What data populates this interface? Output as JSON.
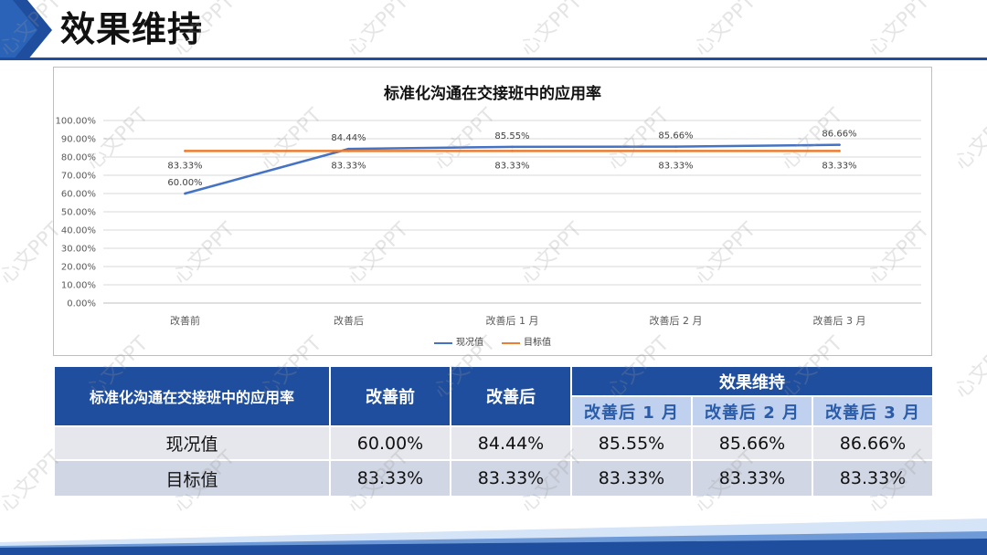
{
  "slide": {
    "title": "效果维持",
    "watermark": "心文PPT",
    "colors": {
      "primary": "#1f4e9e",
      "subheader_bg": "#bfd1ee",
      "subheader_text": "#2a5caa",
      "row_1_bg": "#e6e7ec",
      "row_2_bg": "#d0d6e3"
    }
  },
  "chart_data": {
    "type": "line",
    "title": "标准化沟通在交接班中的应用率",
    "categories": [
      "改善前",
      "改善后",
      "改善后 1 月",
      "改善后 2 月",
      "改善后 3 月"
    ],
    "ylim": [
      0,
      100
    ],
    "yticks": [
      0,
      10,
      20,
      30,
      40,
      50,
      60,
      70,
      80,
      90,
      100
    ],
    "ytick_labels": [
      "0.00%",
      "10.00%",
      "20.00%",
      "30.00%",
      "40.00%",
      "50.00%",
      "60.00%",
      "70.00%",
      "80.00%",
      "90.00%",
      "100.00%"
    ],
    "grid": true,
    "legend": "bottom",
    "series": [
      {
        "name": "现况值",
        "color": "#4472c4",
        "values": [
          60.0,
          84.44,
          85.55,
          85.66,
          86.66
        ],
        "labels": [
          "60.00%",
          "84.44%",
          "85.55%",
          "85.66%",
          "86.66%"
        ],
        "label_position": "above"
      },
      {
        "name": "目标值",
        "color": "#ed7d31",
        "values": [
          83.33,
          83.33,
          83.33,
          83.33,
          83.33
        ],
        "labels": [
          "83.33%",
          "83.33%",
          "83.33%",
          "83.33%",
          "83.33%"
        ],
        "label_position": "below"
      }
    ]
  },
  "table": {
    "header": {
      "metric": "标准化沟通在交接班中的应用率",
      "before": "改善前",
      "after": "改善后",
      "group": "效果维持",
      "sub": [
        "改善后 1 月",
        "改善后 2 月",
        "改善后 3 月"
      ]
    },
    "rows": [
      {
        "label": "现况值",
        "cells": [
          "60.00%",
          "84.44%",
          "85.55%",
          "85.66%",
          "86.66%"
        ]
      },
      {
        "label": "目标值",
        "cells": [
          "83.33%",
          "83.33%",
          "83.33%",
          "83.33%",
          "83.33%"
        ]
      }
    ]
  }
}
